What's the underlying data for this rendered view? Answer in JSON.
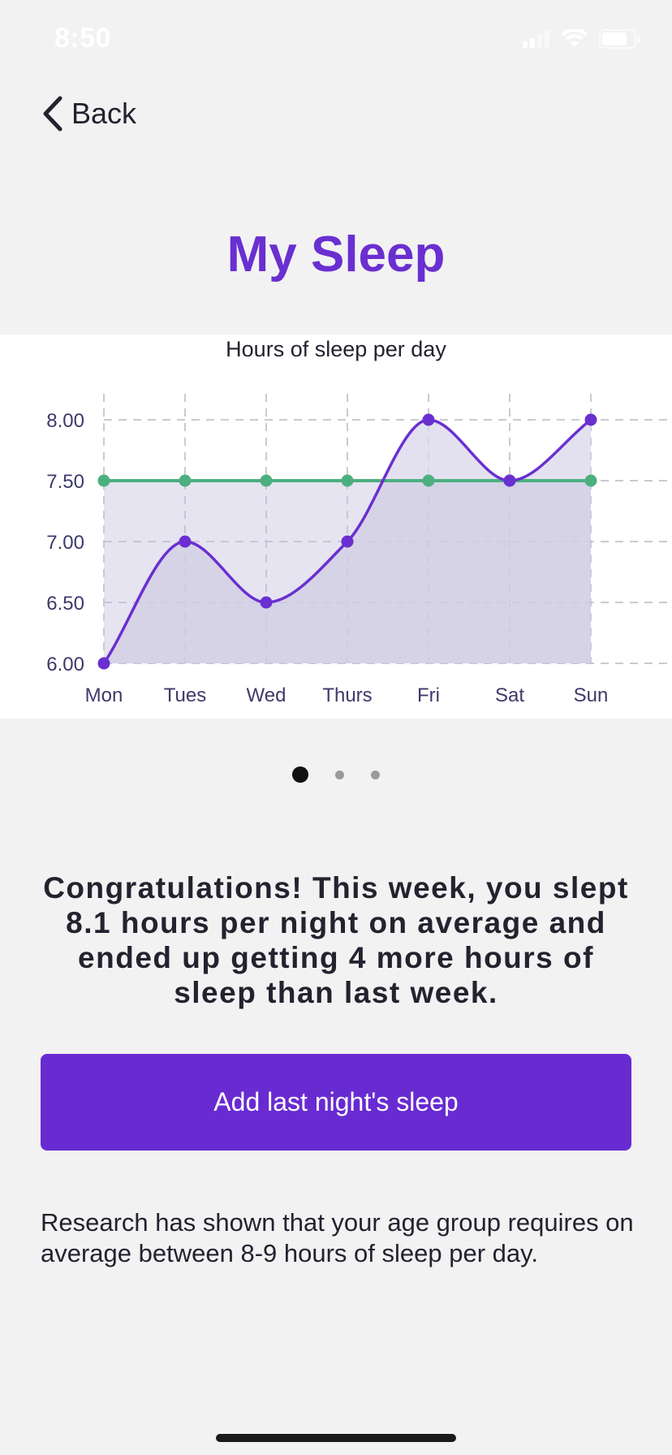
{
  "status_bar": {
    "time": "8:50"
  },
  "nav": {
    "back_label": "Back"
  },
  "page": {
    "title": "My Sleep"
  },
  "chart_data": {
    "type": "line",
    "title": "Hours of sleep per day",
    "xlabel": "",
    "ylabel": "",
    "categories": [
      "Mon",
      "Tues",
      "Wed",
      "Thurs",
      "Fri",
      "Sat",
      "Sun"
    ],
    "y_ticks": [
      "6.00",
      "6.50",
      "7.00",
      "7.50",
      "8.00"
    ],
    "ylim": [
      6.0,
      8.0
    ],
    "grid": true,
    "series": [
      {
        "values": [
          6.0,
          7.0,
          6.5,
          7.0,
          8.0,
          7.5,
          8.0
        ],
        "color": "#6a2fd0",
        "smooth": true,
        "fill": "#d9d7ea"
      },
      {
        "values": [
          7.5,
          7.5,
          7.5,
          7.5,
          7.5,
          7.5,
          7.5
        ],
        "color": "#4caf7f"
      }
    ]
  },
  "pager": {
    "count": 3,
    "active_index": 0
  },
  "summary": {
    "text": "Congratulations! This week, you slept 8.1 hours per night on average and ended up getting 4 more hours of sleep than last week."
  },
  "actions": {
    "add_sleep_label": "Add last night's sleep"
  },
  "info": {
    "research_text": "Research has shown that your age group requires on average between 8-9 hours of sleep per day."
  },
  "colors": {
    "accent": "#6a2fd0",
    "button": "#682bd1",
    "target_line": "#4caf7f"
  }
}
